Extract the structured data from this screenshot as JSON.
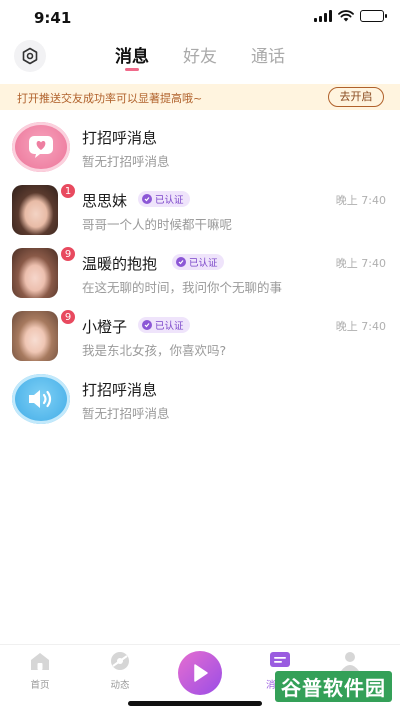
{
  "status_bar": {
    "time": "9:41",
    "battery_level": 1.0
  },
  "top_nav": {
    "settings_icon": "settings-icon",
    "tabs": [
      {
        "label": "消息",
        "active": true
      },
      {
        "label": "好友",
        "active": false
      },
      {
        "label": "通话",
        "active": false
      }
    ]
  },
  "promo": {
    "text": "打开推送交友成功率可以显著提高哦~",
    "button_label": "去开启"
  },
  "chats": [
    {
      "name": "打招呼消息",
      "preview": "暂无打招呼消息",
      "time": "",
      "badge": "",
      "verified": "",
      "avatar": "heart-icon"
    },
    {
      "name": "思思妹",
      "preview": "哥哥一个人的时候都干嘛呢",
      "time": "晚上 7:40",
      "badge": "1",
      "verified": "已认证",
      "avatar": "user-photo"
    },
    {
      "name": "温暖的抱抱",
      "preview": "在这无聊的时间，我问你个无聊的事",
      "time": "晚上 7:40",
      "badge": "9",
      "verified": "已认证",
      "avatar": "user-photo"
    },
    {
      "name": "小橙子",
      "preview": "我是东北女孩，你喜欢吗?",
      "time": "晚上 7:40",
      "badge": "9",
      "verified": "已认证",
      "avatar": "user-photo"
    },
    {
      "name": "打招呼消息",
      "preview": "暂无打招呼消息",
      "time": "",
      "badge": "",
      "verified": "",
      "avatar": "speaker-icon"
    }
  ],
  "bottom_nav": {
    "items": [
      {
        "label": "首页",
        "icon": "home-icon"
      },
      {
        "label": "动态",
        "icon": "moments-icon"
      },
      {
        "label": "",
        "icon": "play-icon"
      },
      {
        "label": "消",
        "icon": "message-icon"
      },
      {
        "label": "",
        "icon": "profile-icon"
      }
    ]
  },
  "watermark": {
    "text": "谷普软件园"
  },
  "colors": {
    "accent_pink": "#f06a8a",
    "promo_bg": "#fff4df",
    "promo_text": "#b0612b",
    "badge_red": "#e84a5f",
    "verified_purple": "#7b46c9",
    "play_gradient_start": "#e66ed0",
    "play_gradient_end": "#9a4de6"
  }
}
